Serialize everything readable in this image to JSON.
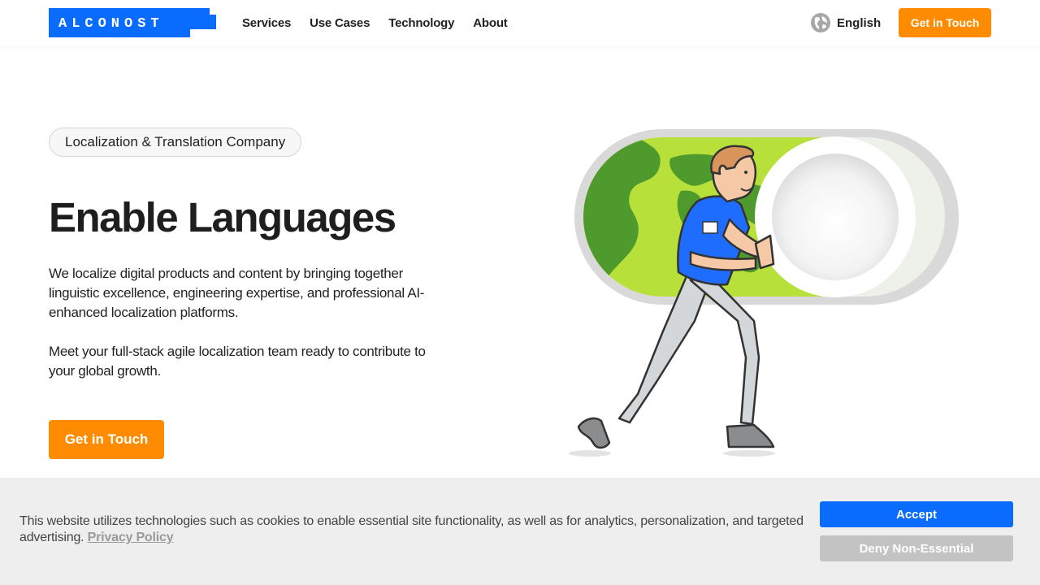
{
  "header": {
    "logo_text": "ALCONOST",
    "nav": [
      "Services",
      "Use Cases",
      "Technology",
      "About"
    ],
    "language": "English",
    "cta_label": "Get in Touch"
  },
  "hero": {
    "badge": "Localization & Translation Company",
    "title": "Enable Languages",
    "paragraph_1": "We localize digital products and content by bringing together linguistic excellence, engineering expertise, and professional AI-enhanced localization platforms.",
    "paragraph_2": "Meet your full-stack agile localization team ready to contribute to your global growth.",
    "cta_label": "Get in Touch"
  },
  "cookie_banner": {
    "text": "This website utilizes technologies such as cookies to enable essential site functionality, as well as for analytics, personalization, and targeted advertising.",
    "privacy_link": "Privacy Policy",
    "accept_label": "Accept",
    "deny_label": "Deny Non-Essential"
  },
  "icons": {
    "logo": "alconost-logo",
    "language": "globe-icon",
    "illustration": "person-pushing-toggle-illustration"
  },
  "colors": {
    "brand_blue": "#0a6cff",
    "cta_orange": "#ff8c00",
    "toggle_green": "#b8e03a",
    "map_green": "#4f9a2c",
    "cookie_bg": "#eeeeee"
  }
}
